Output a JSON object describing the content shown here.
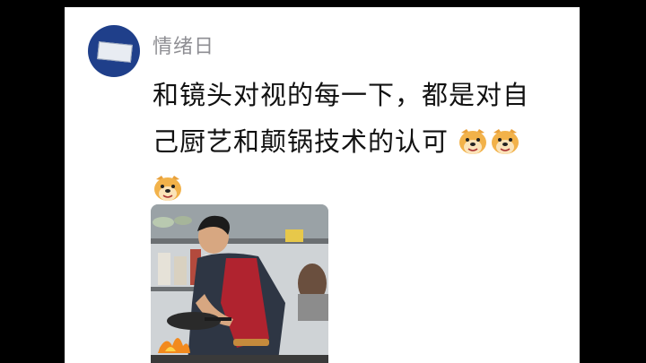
{
  "post": {
    "username": "情绪日",
    "avatar_icon": "profile-avatar-icon",
    "text_line1": "和镜头对视的每一下，都是对自",
    "text_line2": "己厨艺和颠锅技术的认可",
    "emoji_name": "doge-emoji-icon",
    "emoji_count": 3,
    "image_icon": "cooking-photo"
  },
  "colors": {
    "background": "#000000",
    "card": "#ffffff",
    "username": "#8e8e93",
    "text": "#111111",
    "avatar": "#1f3f8a"
  }
}
